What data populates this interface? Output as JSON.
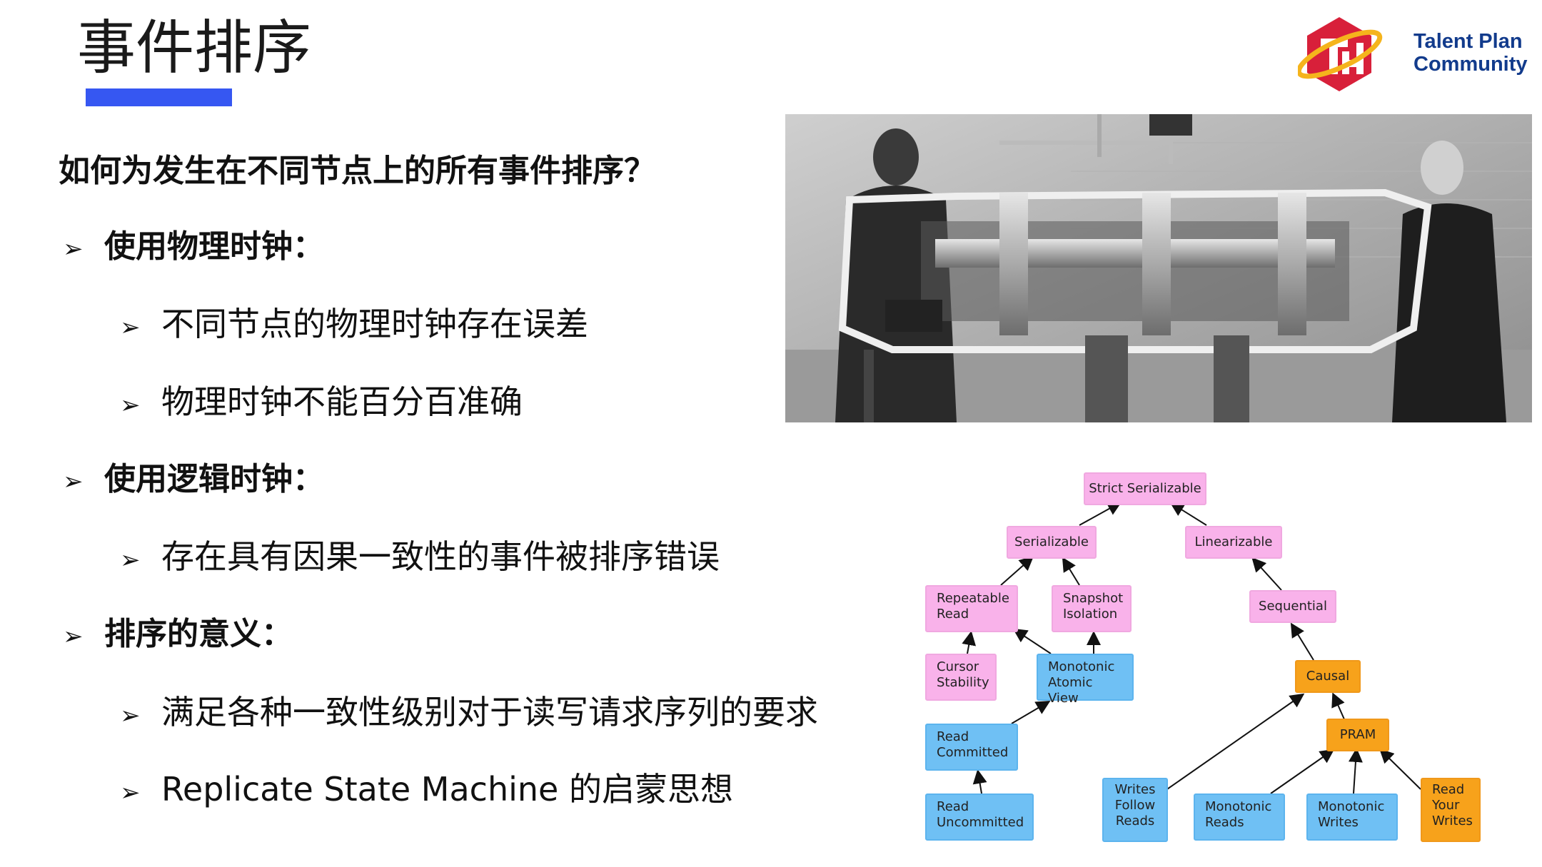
{
  "slide": {
    "title": "事件排序",
    "accent_color": "#3657f2"
  },
  "logo": {
    "line1": "Talent Plan",
    "line2": "Community",
    "icon": "talent-plan-hexagon-logo"
  },
  "content": {
    "question": "如何为发生在不同节点上的所有事件排序？",
    "bullets": [
      {
        "arrow": "➢",
        "text": "使用物理时钟："
      },
      {
        "arrow": "➢",
        "text": "不同节点的物理时钟存在误差"
      },
      {
        "arrow": "➢",
        "text": "物理时钟不能百分百准确"
      },
      {
        "arrow": "➢",
        "text": "使用逻辑时钟："
      },
      {
        "arrow": "➢",
        "text": "存在具有因果一致性的事件被排序错误"
      },
      {
        "arrow": "➢",
        "text": "排序的意义："
      },
      {
        "arrow": "➢",
        "text": "满足各种一致性级别对于读写请求序列的要求"
      },
      {
        "arrow": "➢",
        "text": "Replicate State Machine 的启蒙思想"
      }
    ]
  },
  "photo": {
    "icon": "historical-lab-photo"
  },
  "diagram": {
    "nodes": {
      "strict_serializable": "Strict Serializable",
      "serializable": "Serializable",
      "linearizable": "Linearizable",
      "repeatable_read_1": "Repeatable",
      "repeatable_read_2": "Read",
      "snapshot_isolation_1": "Snapshot",
      "snapshot_isolation_2": "Isolation",
      "sequential": "Sequential",
      "cursor_stability_1": "Cursor",
      "cursor_stability_2": "Stability",
      "monotonic_atomic_view_1": "Monotonic",
      "monotonic_atomic_view_2": "Atomic View",
      "causal": "Causal",
      "read_committed_1": "Read",
      "read_committed_2": "Committed",
      "pram": "PRAM",
      "read_uncommitted_1": "Read",
      "read_uncommitted_2": "Uncommitted",
      "writes_follow_reads_1": "Writes",
      "writes_follow_reads_2": "Follow",
      "writes_follow_reads_3": "Reads",
      "monotonic_reads_1": "Monotonic",
      "monotonic_reads_2": "Reads",
      "monotonic_writes_1": "Monotonic",
      "monotonic_writes_2": "Writes",
      "read_your_writes_1": "Read",
      "read_your_writes_2": "Your",
      "read_your_writes_3": "Writes"
    },
    "colors": {
      "unavailable": "#f9b2ea",
      "sticky": "#f7a21b",
      "total": "#6fc0f4"
    }
  }
}
